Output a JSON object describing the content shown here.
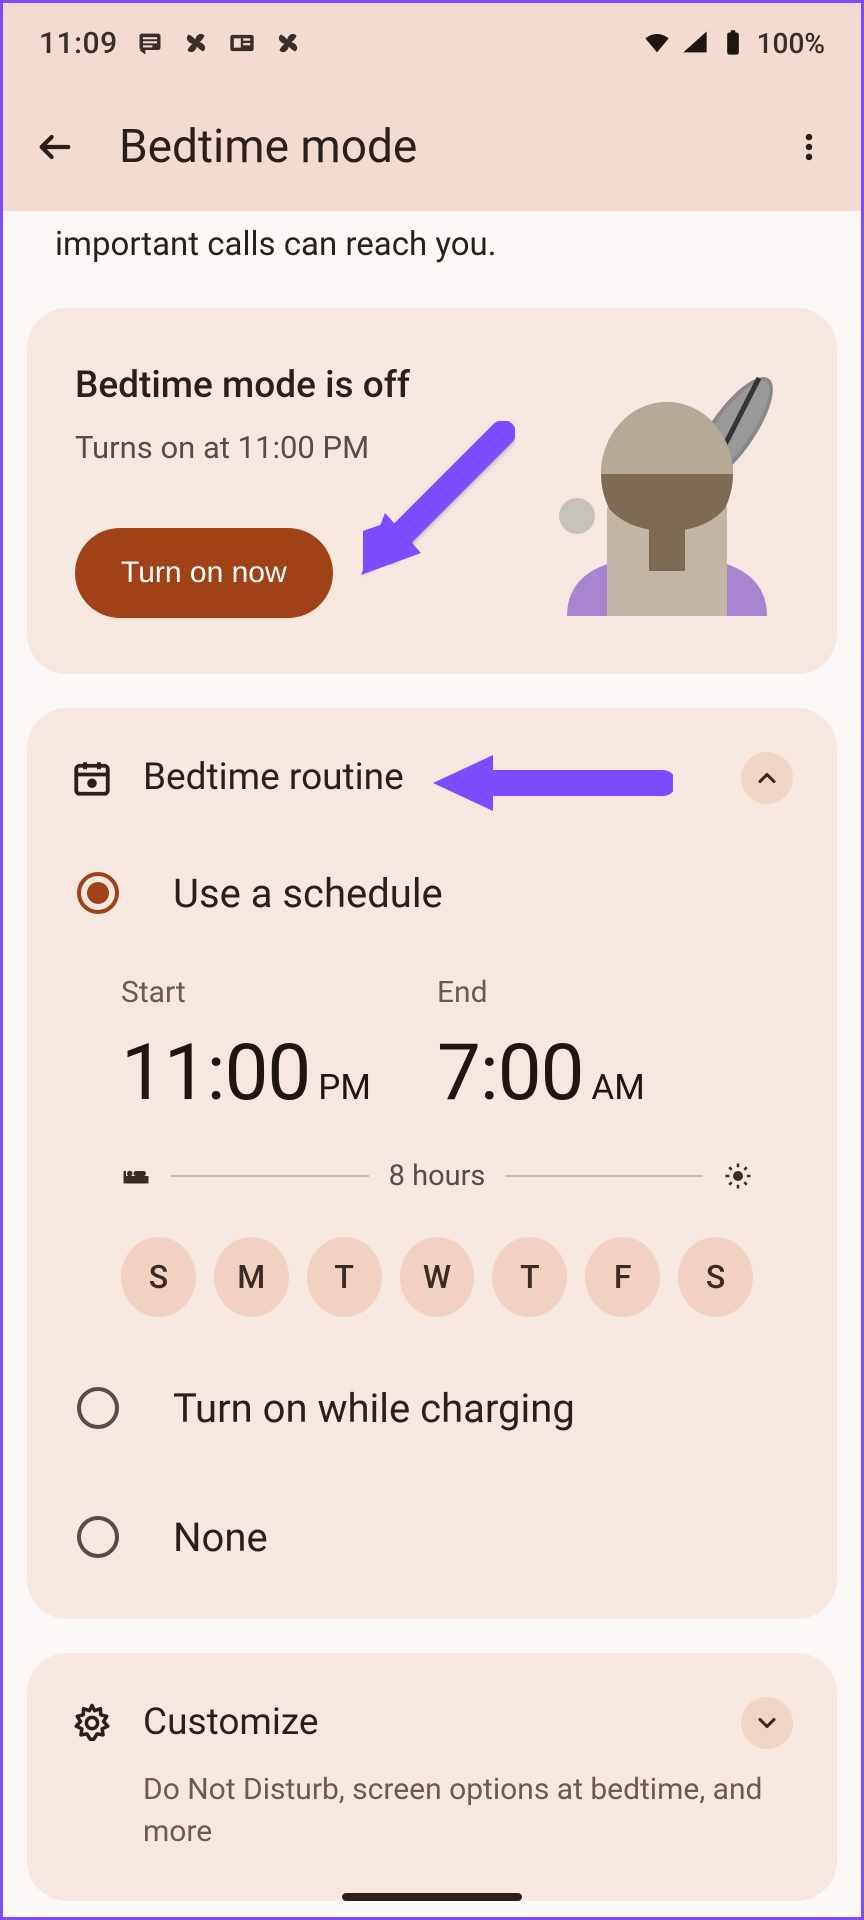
{
  "statusbar": {
    "time": "11:09",
    "battery_text": "100%"
  },
  "appbar": {
    "title": "Bedtime mode"
  },
  "intro_text": "important calls can reach you.",
  "status_card": {
    "title": "Bedtime mode is off",
    "subtitle": "Turns on at 11:00 PM",
    "button": "Turn on now"
  },
  "routine": {
    "title": "Bedtime routine",
    "options": {
      "schedule": "Use a schedule",
      "charging": "Turn on while charging",
      "none": "None"
    },
    "start_label": "Start",
    "end_label": "End",
    "start_time": "11:00",
    "start_ampm": "PM",
    "end_time": "7:00",
    "end_ampm": "AM",
    "duration": "8 hours",
    "days": [
      "S",
      "M",
      "T",
      "W",
      "T",
      "F",
      "S"
    ]
  },
  "customize": {
    "title": "Customize",
    "subtitle": "Do Not Disturb, screen options at bedtime, and more"
  }
}
